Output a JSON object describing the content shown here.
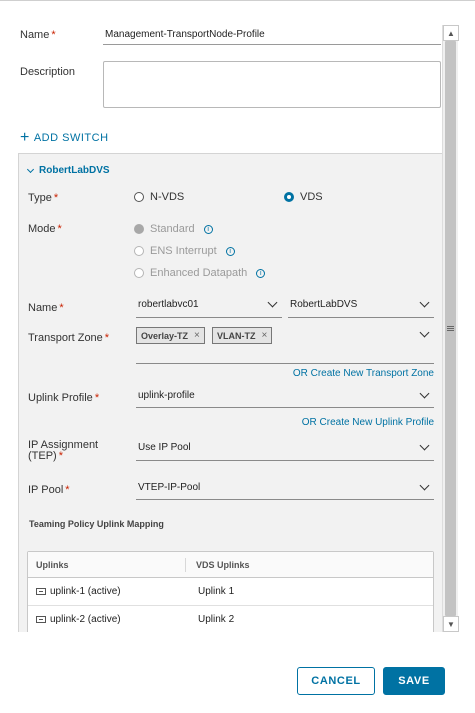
{
  "form": {
    "name_label": "Name",
    "name_value": "Management-TransportNode-Profile",
    "description_label": "Description",
    "description_value": "",
    "add_switch_label": "ADD SWITCH"
  },
  "switch": {
    "title": "RobertLabDVS",
    "type_label": "Type",
    "type_options": [
      "N-VDS",
      "VDS"
    ],
    "type_selected": "VDS",
    "mode_label": "Mode",
    "mode_options": [
      "Standard",
      "ENS Interrupt",
      "Enhanced Datapath"
    ],
    "name_label": "Name",
    "vcenter_value": "robertlabvc01",
    "vds_value": "RobertLabDVS",
    "transport_zone_label": "Transport Zone",
    "transport_zones": [
      "Overlay-TZ",
      "VLAN-TZ"
    ],
    "create_tz_link": "OR Create New Transport Zone",
    "uplink_profile_label": "Uplink Profile",
    "uplink_profile_value": "uplink-profile",
    "create_uplink_link": "OR Create New Uplink Profile",
    "ip_assignment_label": "IP Assignment (TEP)",
    "ip_assignment_value": "Use IP Pool",
    "ip_pool_label": "IP Pool",
    "ip_pool_value": "VTEP-IP-Pool",
    "teaming_heading": "Teaming Policy Uplink Mapping"
  },
  "table": {
    "headers": [
      "Uplinks",
      "VDS Uplinks"
    ],
    "rows": [
      {
        "uplink": "uplink-1 (active)",
        "vds_uplink": "Uplink 1"
      },
      {
        "uplink": "uplink-2 (active)",
        "vds_uplink": "Uplink 2"
      }
    ]
  },
  "footer": {
    "cancel_label": "CANCEL",
    "save_label": "SAVE"
  },
  "colors": {
    "accent": "#0072a3",
    "required": "#c92100"
  }
}
